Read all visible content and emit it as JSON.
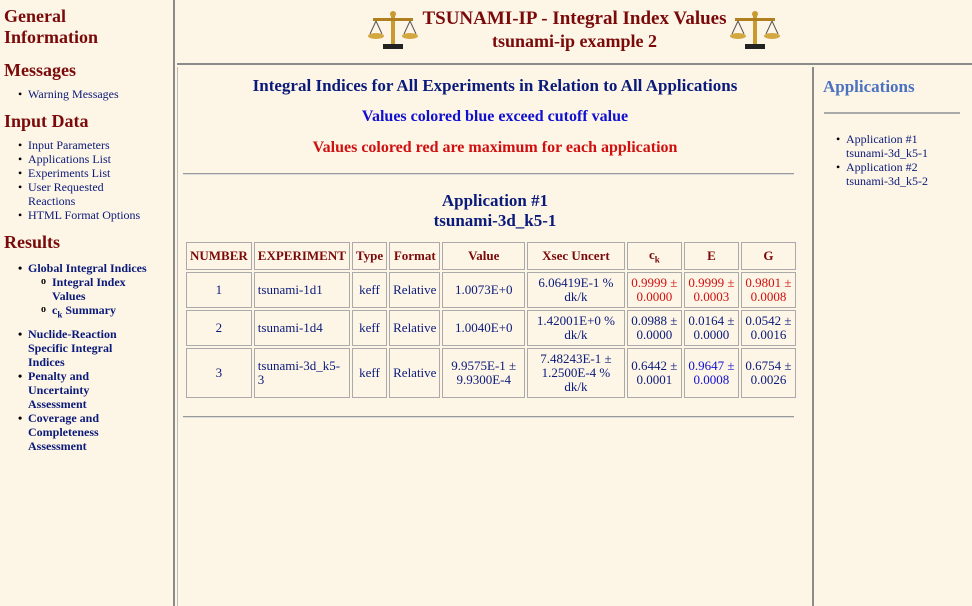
{
  "header": {
    "title": "TSUNAMI-IP - Integral Index Values",
    "subtitle": "tsunami-ip example 2",
    "left_icon": "scales-icon",
    "right_icon": "scales-icon"
  },
  "sidebar": {
    "general": "General Information",
    "messages": "Messages",
    "messages_items": [
      "Warning Messages"
    ],
    "input_data": "Input Data",
    "input_items": [
      "Input Parameters",
      "Applications List",
      "Experiments List",
      "User Requested Reactions",
      "HTML Format Options"
    ],
    "results": "Results",
    "results_items": {
      "global": "Global Integral Indices",
      "global_sub1": "Integral Index Values",
      "global_sub2_prefix": "c",
      "global_sub2_subscript": "k",
      "global_sub2_suffix": " Summary",
      "nuclide": "Nuclide-Reaction Specific Integral Indices",
      "penalty": "Penalty and Uncertainty Assessment",
      "coverage": "Coverage and Completeness Assessment"
    }
  },
  "main": {
    "heading": "Integral Indices for All Experiments in Relation to All Applications",
    "blue_note": "Values colored blue exceed cutoff value",
    "red_note": "Values colored red are maximum for each application",
    "app_title": "Application #1",
    "app_name": "tsunami-3d_k5-1",
    "table": {
      "headers": {
        "number": "NUMBER",
        "experiment": "EXPERIMENT",
        "type": "Type",
        "format": "Format",
        "value": "Value",
        "xsec": "Xsec Uncert",
        "ck_prefix": "c",
        "ck_sub": "k",
        "e": "E",
        "g": "G"
      },
      "rows": [
        {
          "number": "1",
          "experiment": "tsunami-1d1",
          "type": "keff",
          "format": "Relative",
          "value": "1.0073E+0",
          "xsec": "6.06419E-1 % dk/k",
          "ck": "0.9999 ± 0.0000",
          "e": "0.9999 ± 0.0003",
          "g": "0.9801 ± 0.0008"
        },
        {
          "number": "2",
          "experiment": "tsunami-1d4",
          "type": "keff",
          "format": "Relative",
          "value": "1.0040E+0",
          "xsec": "1.42001E+0 % dk/k",
          "ck": "0.0988 ± 0.0000",
          "e": "0.0164 ± 0.0000",
          "g": "0.0542 ± 0.0016"
        },
        {
          "number": "3",
          "experiment": "tsunami-3d_k5-3",
          "type": "keff",
          "format": "Relative",
          "value": "9.9575E-1 ± 9.9300E-4",
          "xsec": "7.48243E-1 ± 1.2500E-4 % dk/k",
          "ck": "0.6442 ± 0.0001",
          "e": "0.9647 ± 0.0008",
          "g": "0.6754 ± 0.0026"
        }
      ]
    }
  },
  "right": {
    "heading": "Applications",
    "items": [
      {
        "line1": "Application #1",
        "line2": "tsunami-3d_k5-1"
      },
      {
        "line1": "Application #2",
        "line2": "tsunami-3d_k5-2"
      }
    ]
  },
  "colors": {
    "background": "#fdf5e6",
    "heading_red": "#7a0a0a",
    "navy": "#0a1a7a",
    "cutoff_blue": "#1010d0",
    "max_red": "#d01010",
    "apps_blue": "#4a72c0"
  }
}
